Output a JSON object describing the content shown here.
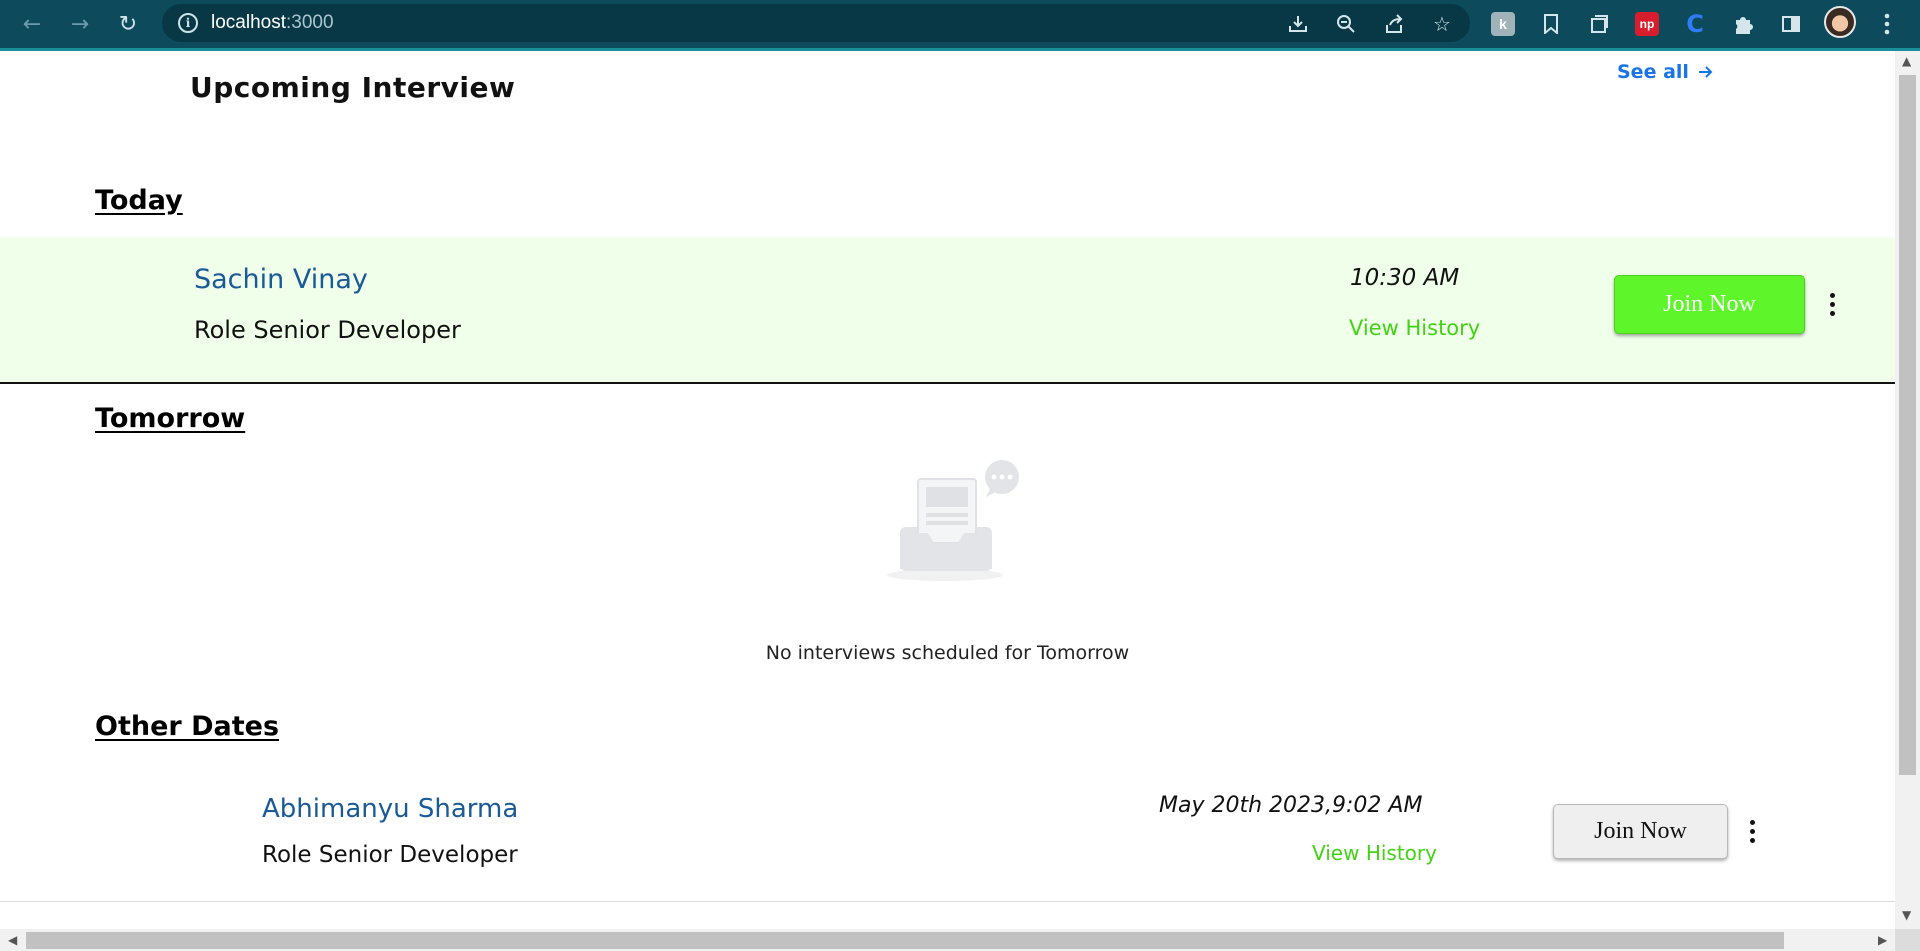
{
  "browser": {
    "url_host": "localhost",
    "url_port": ":3000"
  },
  "header": {
    "title": "Upcoming Interview",
    "see_all": "See all"
  },
  "sections": {
    "today": {
      "title": "Today",
      "interview": {
        "name": "Sachin Vinay",
        "role": "Role Senior Developer",
        "time": "10:30 AM",
        "history": "View History",
        "join": "Join Now"
      }
    },
    "tomorrow": {
      "title": "Tomorrow",
      "empty_text": "No interviews scheduled for Tomorrow"
    },
    "other": {
      "title": "Other Dates",
      "interview": {
        "name": "Abhimanyu Sharma",
        "role": "Role Senior Developer",
        "time": "May 20th 2023,9:02 AM",
        "history": "View History",
        "join": "Join Now"
      }
    }
  },
  "colors": {
    "chrome": "#0c4a5c",
    "today_bg": "#f0ffea",
    "accent_green": "#5ef52a",
    "history_green": "#43d115",
    "name_blue": "#1a5a96",
    "link_blue": "#1a73e8"
  },
  "icons": {
    "back": "arrow-left-icon",
    "forward": "arrow-right-icon",
    "reload": "reload-icon",
    "info": "info-icon",
    "menu": "kebab-menu-icon"
  }
}
